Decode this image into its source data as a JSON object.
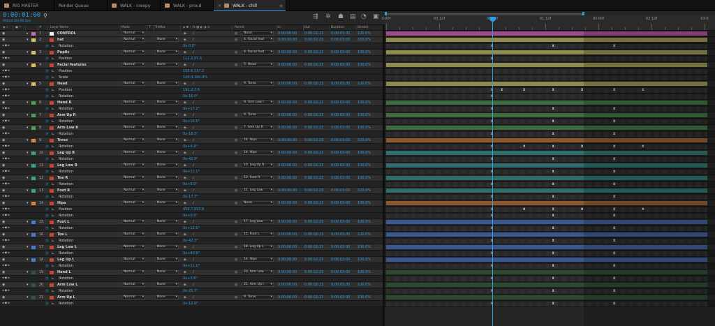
{
  "tabs": [
    {
      "label": "RIG MASTER",
      "color": "#b58a6a",
      "active": false,
      "close": false
    },
    {
      "label": "Render Queue",
      "color": null,
      "active": false,
      "close": false
    },
    {
      "label": "WALK - creepy",
      "color": "#b58a6a",
      "active": false,
      "close": false
    },
    {
      "label": "WALK - proud",
      "color": "#b58a6a",
      "active": false,
      "close": false
    },
    {
      "label": "WALK - chill",
      "color": "#b58a6a",
      "active": true,
      "close": true
    }
  ],
  "header": {
    "timecode": "0:00:01:00",
    "fps": "00024 (24.00 fps)",
    "search_icon": "search-icon"
  },
  "columns": {
    "num": "#",
    "layer_name": "Layer Name",
    "mode": "Mode",
    "t": "T",
    "trkmat": "TrkMat",
    "parent": "Parent",
    "in": "In",
    "out": "Out",
    "duration": "Duration",
    "stretch": "Stretch"
  },
  "ruler": [
    "0:00f",
    "00:12f",
    "01:00f",
    "01:12f",
    "02:00f",
    "02:12f",
    "03:0"
  ],
  "accent": "#2e9de0",
  "layers": [
    {
      "num": "1",
      "name": "CONTROL",
      "label": "#c86ab4",
      "bar": "#a04a90",
      "mode": "Normal",
      "trkmat": "",
      "parent": "None",
      "parent_pick": false,
      "in": "0:00:00:00",
      "out": "0:00:02:23",
      "duration": "0:00:03:00",
      "stretch": "100.0%",
      "solid": true,
      "props": []
    },
    {
      "num": "2",
      "name": "hat",
      "label": "#d9c25c",
      "bar": "#8f8a4d",
      "mode": "Normal",
      "trkmat": "None",
      "parent": "4. Facial feat",
      "parent_pick": true,
      "in": "0:00:00:00",
      "out": "0:00:02:23",
      "duration": "0:00:03:00",
      "stretch": "100.0%",
      "props": [
        {
          "name": "Rotation",
          "value": "0x-0.0°",
          "keys": [
            0.33,
            0.52,
            0.71
          ]
        }
      ]
    },
    {
      "num": "3",
      "name": "Pupils",
      "label": "#d9c25c",
      "bar": "#8f8a4d",
      "mode": "Normal",
      "trkmat": "None",
      "parent": "4. Facial feat",
      "parent_pick": true,
      "in": "0:00:00:00",
      "out": "0:00:02:23",
      "duration": "0:00:03:00",
      "stretch": "100.0%",
      "props": [
        {
          "name": "Position",
          "value": "112.2,55.6",
          "keys": [
            0.33
          ]
        }
      ]
    },
    {
      "num": "4",
      "name": "Facial features",
      "label": "#d9c25c",
      "bar": "#8f8a4d",
      "mode": "Normal",
      "trkmat": "None",
      "parent": "5. Head",
      "parent_pick": true,
      "in": "0:00:00:00",
      "out": "0:00:02:23",
      "duration": "0:00:03:00",
      "stretch": "100.0%",
      "props": [
        {
          "name": "Position",
          "value": "155.6,137.2",
          "keys": []
        },
        {
          "name": "Scale",
          "value": "100.0,100.0%",
          "keys": []
        }
      ]
    },
    {
      "num": "5",
      "name": "Head",
      "label": "#d9c25c",
      "bar": "#8f8a4d",
      "mode": "Normal",
      "trkmat": "None",
      "parent": "9. Torso",
      "parent_pick": true,
      "in": "0:00:00:00",
      "out": "0:00:02:23",
      "duration": "0:00:03:00",
      "stretch": "100.0%",
      "props": [
        {
          "name": "Position",
          "value": "191.2,7.6",
          "keys": [
            0.33,
            0.36,
            0.43,
            0.52,
            0.61,
            0.71,
            0.8
          ]
        },
        {
          "name": "Rotation",
          "value": "0x-16.0°",
          "keys": [
            0.33
          ]
        }
      ]
    },
    {
      "num": "6",
      "name": "Hand R",
      "label": "#4aa05a",
      "bar": "#3d6b40",
      "mode": "Normal",
      "trkmat": "None",
      "parent": "8. Arm Low I",
      "parent_pick": true,
      "in": "0:00:00:00",
      "out": "0:00:02:23",
      "duration": "0:00:03:00",
      "stretch": "100.0%",
      "props": [
        {
          "name": "Rotation",
          "value": "0x+17.2°",
          "keys": [
            0.33,
            0.52,
            0.71
          ]
        }
      ]
    },
    {
      "num": "7",
      "name": "Arm Up R",
      "label": "#4aa05a",
      "bar": "#3d6b40",
      "mode": "Normal",
      "trkmat": "None",
      "parent": "9. Torso",
      "parent_pick": true,
      "in": "0:00:00:00",
      "out": "0:00:02:23",
      "duration": "0:00:03:00",
      "stretch": "100.0%",
      "props": [
        {
          "name": "Rotation",
          "value": "0x+10.5°",
          "keys": [
            0.33,
            0.52,
            0.71
          ]
        }
      ]
    },
    {
      "num": "8",
      "name": "Arm Low R",
      "label": "#4aa05a",
      "bar": "#3d6b40",
      "mode": "Normal",
      "trkmat": "None",
      "parent": "7. Arm Up R",
      "parent_pick": true,
      "in": "0:00:00:00",
      "out": "0:00:02:23",
      "duration": "0:00:03:00",
      "stretch": "100.0%",
      "props": [
        {
          "name": "Rotation",
          "value": "0x-18.5°",
          "keys": [
            0.33,
            0.52,
            0.71
          ]
        }
      ]
    },
    {
      "num": "9",
      "name": "Torso",
      "label": "#e0853a",
      "bar": "#8a5a2e",
      "mode": "Normal",
      "trkmat": "None",
      "parent": "14. Hips",
      "parent_pick": true,
      "in": "0:00:00:00",
      "out": "0:00:02:23",
      "duration": "0:00:03:00",
      "stretch": "100.0%",
      "props": [
        {
          "name": "Rotation",
          "value": "0x+4.9°",
          "keys": [
            0.33,
            0.43,
            0.52,
            0.61,
            0.71,
            0.8
          ]
        }
      ]
    },
    {
      "num": "10",
      "name": "Leg Up R",
      "label": "#3a9e9a",
      "bar": "#2e6d6b",
      "mode": "Normal",
      "trkmat": "None",
      "parent": "14. Hips",
      "parent_pick": true,
      "in": "0:00:00:00",
      "out": "0:00:02:23",
      "duration": "0:00:03:00",
      "stretch": "100.0%",
      "props": [
        {
          "name": "Rotation",
          "value": "0x-42.9°",
          "keys": [
            0.33,
            0.52,
            0.71
          ]
        }
      ]
    },
    {
      "num": "11",
      "name": "Leg Low R",
      "label": "#3a9e9a",
      "bar": "#2e6d6b",
      "mode": "Normal",
      "trkmat": "None",
      "parent": "10. Leg Up R",
      "parent_pick": true,
      "in": "0:00:00:00",
      "out": "0:00:02:23",
      "duration": "0:00:03:00",
      "stretch": "100.0%",
      "props": [
        {
          "name": "Rotation",
          "value": "0x+11.1°",
          "keys": [
            0.33,
            0.52,
            0.71
          ]
        }
      ]
    },
    {
      "num": "12",
      "name": "Toe R",
      "label": "#3a9e9a",
      "bar": "#2e6d6b",
      "mode": "Normal",
      "trkmat": "None",
      "parent": "13. Foot R",
      "parent_pick": true,
      "in": "0:00:00:00",
      "out": "0:00:02:23",
      "duration": "0:00:03:00",
      "stretch": "100.0%",
      "props": [
        {
          "name": "Rotation",
          "value": "0x+0.0°",
          "keys": [
            0.33,
            0.52,
            0.71
          ]
        }
      ]
    },
    {
      "num": "13",
      "name": "Foot R",
      "label": "#3a9e9a",
      "bar": "#2e6d6b",
      "mode": "Normal",
      "trkmat": "None",
      "parent": "11. Leg Low",
      "parent_pick": true,
      "in": "0:00:00:00",
      "out": "0:00:02:23",
      "duration": "0:00:03:00",
      "stretch": "100.0%",
      "props": [
        {
          "name": "Rotation",
          "value": "0x-17.7°",
          "keys": [
            0.33,
            0.52,
            0.71
          ]
        }
      ]
    },
    {
      "num": "14",
      "name": "Hips",
      "label": "#e0853a",
      "bar": "#8a5a2e",
      "mode": "Normal",
      "trkmat": "None",
      "parent": "None",
      "parent_pick": false,
      "in": "0:00:00:00",
      "out": "0:00:02:23",
      "duration": "0:00:03:00",
      "stretch": "100.0%",
      "props": [
        {
          "name": "Position",
          "value": "459.7,603.8",
          "keys": [
            0.33,
            0.43,
            0.52,
            0.61,
            0.71,
            0.8
          ]
        },
        {
          "name": "Rotation",
          "value": "0x+0.0°",
          "keys": [
            0.33,
            0.52,
            0.71
          ]
        }
      ]
    },
    {
      "num": "15",
      "name": "Foot L",
      "label": "#4a78c8",
      "bar": "#3a5890",
      "mode": "Normal",
      "trkmat": "None",
      "parent": "17. Leg Low",
      "parent_pick": true,
      "in": "0:00:00:00",
      "out": "0:00:02:23",
      "duration": "0:00:03:00",
      "stretch": "100.0%",
      "props": [
        {
          "name": "Rotation",
          "value": "0x+12.5°",
          "keys": [
            0.33,
            0.52,
            0.71
          ]
        }
      ]
    },
    {
      "num": "16",
      "name": "Toe L",
      "label": "#4a78c8",
      "bar": "#3a5890",
      "mode": "Normal",
      "trkmat": "None",
      "parent": "15. Foot L",
      "parent_pick": true,
      "in": "0:00:00:00",
      "out": "0:00:02:23",
      "duration": "0:00:03:00",
      "stretch": "100.0%",
      "props": [
        {
          "name": "Rotation",
          "value": "0x-42.3°",
          "keys": [
            0.33,
            0.52,
            0.71
          ]
        }
      ]
    },
    {
      "num": "17",
      "name": "Leg Low L",
      "label": "#4a78c8",
      "bar": "#3a5890",
      "mode": "Normal",
      "trkmat": "None",
      "parent": "18. Leg Up L",
      "parent_pick": true,
      "in": "0:00:00:00",
      "out": "0:00:02:23",
      "duration": "0:00:03:00",
      "stretch": "100.0%",
      "props": [
        {
          "name": "Rotation",
          "value": "0x+40.9°",
          "keys": [
            0.33,
            0.52,
            0.71
          ]
        }
      ]
    },
    {
      "num": "18",
      "name": "Leg Up L",
      "label": "#4a78c8",
      "bar": "#3a5890",
      "mode": "Normal",
      "trkmat": "None",
      "parent": "14. Hips",
      "parent_pick": true,
      "in": "0:00:00:00",
      "out": "0:00:02:23",
      "duration": "0:00:03:00",
      "stretch": "100.0%",
      "props": [
        {
          "name": "Rotation",
          "value": "0x+11.1°",
          "keys": [
            0.33,
            0.52,
            0.71
          ]
        }
      ]
    },
    {
      "num": "19",
      "name": "Hand L",
      "label": "#2d5a34",
      "bar": "#2c4a30",
      "mode": "Normal",
      "trkmat": "None",
      "parent": "20. Arm Low",
      "parent_pick": true,
      "in": "0:00:00:00",
      "out": "0:00:02:23",
      "duration": "0:00:03:00",
      "stretch": "100.0%",
      "props": [
        {
          "name": "Rotation",
          "value": "0x+3.6°",
          "keys": [
            0.33,
            0.52,
            0.71
          ]
        }
      ]
    },
    {
      "num": "20",
      "name": "Arm Low L",
      "label": "#2d5a34",
      "bar": "#2c4a30",
      "mode": "Normal",
      "trkmat": "None",
      "parent": "21. Arm Up I",
      "parent_pick": true,
      "in": "0:00:00:00",
      "out": "0:00:02:23",
      "duration": "0:00:03:00",
      "stretch": "100.0%",
      "props": [
        {
          "name": "Rotation",
          "value": "0x-25.7°",
          "keys": [
            0.33,
            0.52,
            0.71
          ]
        }
      ]
    },
    {
      "num": "21",
      "name": "Arm Up L",
      "label": "#2d5a34",
      "bar": "#2c4a30",
      "mode": "Normal",
      "trkmat": "None",
      "parent": "9. Torso",
      "parent_pick": true,
      "in": "0:00:00:00",
      "out": "0:00:02:23",
      "duration": "0:00:03:00",
      "stretch": "100.0%",
      "props": [
        {
          "name": "Rotation",
          "value": "0x-12.9°",
          "keys": [
            0.33,
            0.52,
            0.71
          ]
        }
      ]
    }
  ]
}
